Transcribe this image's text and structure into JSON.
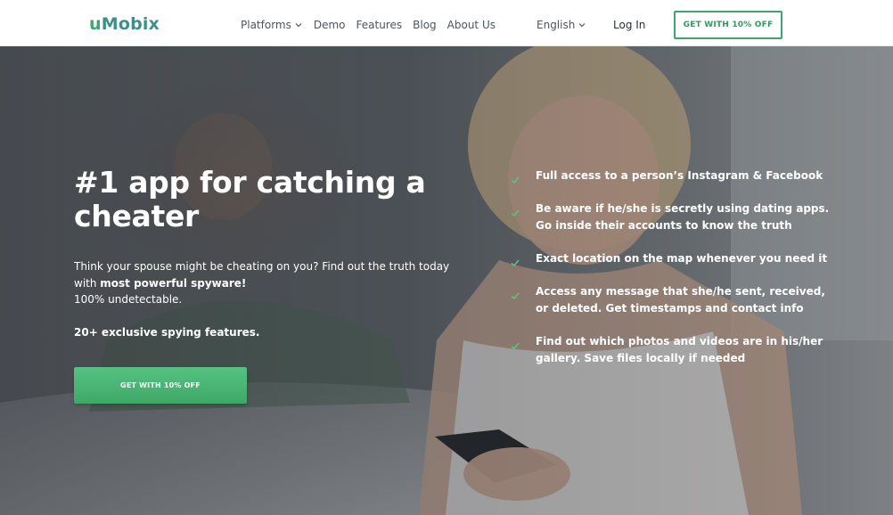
{
  "header": {
    "logo": {
      "first": "u",
      "rest": "Mobix"
    },
    "nav": [
      {
        "label": "Platforms",
        "has_dropdown": true
      },
      {
        "label": "Demo",
        "has_dropdown": false
      },
      {
        "label": "Features",
        "has_dropdown": false
      },
      {
        "label": "Blog",
        "has_dropdown": false
      },
      {
        "label": "About Us",
        "has_dropdown": false
      }
    ],
    "language": "English",
    "login": "Log In",
    "cta": "GET WITH 10% OFF"
  },
  "hero": {
    "title": "#1 app for catching a cheater",
    "text_line1": "Think your spouse might be cheating on you? Find out the truth today with ",
    "text_bold": "most powerful spyware!",
    "text_line2": "100% undetectable.",
    "features_count": "20+ exclusive spying features.",
    "cta": "GET WITH 10% OFF",
    "checklist": [
      "Full access to a person’s Instagram & Facebook",
      "Be aware if he/she is secretly using dating apps. Go inside their accounts to know the truth",
      "Exact location on the map whenever you need it",
      "Access any message that she/he sent, received, or deleted. Get timestamps and contact info",
      "Find out which photos and videos are in his/her gallery. Save files locally if needed"
    ]
  },
  "colors": {
    "brand_green": "#3aa76d",
    "cta_green": "#4cb776",
    "check_green": "#5cc07e",
    "nav_text": "#4d5560"
  },
  "icons": {
    "dropdown": "chevron-down-icon",
    "check": "check-icon"
  }
}
